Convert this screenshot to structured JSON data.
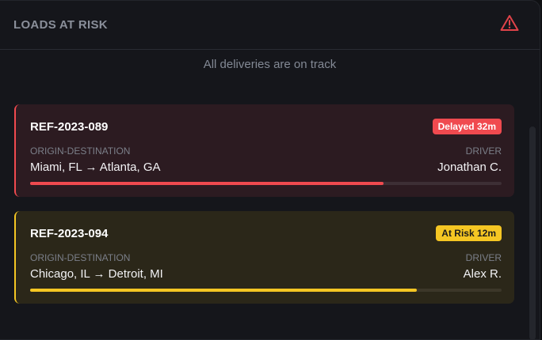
{
  "header": {
    "title": "LOADS AT RISK",
    "icon": "warning-triangle-icon"
  },
  "empty_message": "All deliveries are on track",
  "colors": {
    "delayed": "#f04a4f",
    "at_risk": "#f5c623"
  },
  "loads": [
    {
      "ref": "REF-2023-089",
      "badge": "Delayed 32m",
      "origin_label": "ORIGIN-DESTINATION",
      "route": "Miami, FL → Atlanta, GA",
      "driver_label": "DRIVER",
      "driver": "Jonathan C.",
      "progress": 75
    },
    {
      "ref": "REF-2023-094",
      "badge": "At Risk 12m",
      "origin_label": "ORIGIN-DESTINATION",
      "route": "Chicago, IL → Detroit, MI",
      "driver_label": "DRIVER",
      "driver": "Alex R.",
      "progress": 82
    }
  ]
}
